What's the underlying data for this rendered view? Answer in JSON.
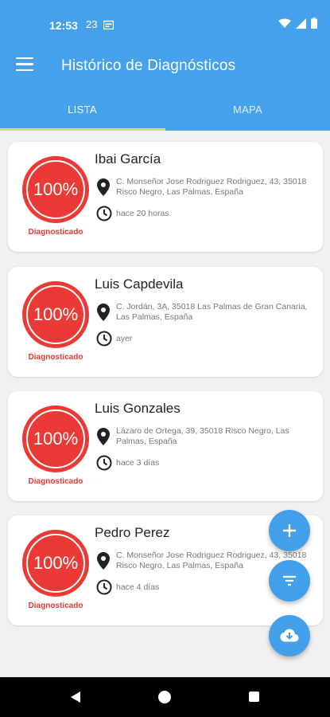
{
  "status_bar": {
    "time": "12:53",
    "indicator": "23"
  },
  "app_bar": {
    "title": "Histórico de Diagnósticos"
  },
  "tabs": [
    {
      "label": "LISTA",
      "selected": true
    },
    {
      "label": "MAPA",
      "selected": false
    }
  ],
  "colors": {
    "primary": "#45a1ec",
    "accent_indicator": "#cfe26a",
    "score_red": "#eb3a35"
  },
  "cards": [
    {
      "name": "Ibai García",
      "score": "100%",
      "status": "Diagnosticado",
      "address": "C. Monseñor Jose Rodriguez Rodriguez, 43, 35018 Risco Negro, Las Palmas, España",
      "time": "hace 20 horas"
    },
    {
      "name": "Luis  Capdevila",
      "score": "100%",
      "status": "Diagnosticado",
      "address": "C. Jordán, 3A, 35018 Las Palmas de Gran Canaria, Las Palmas, España",
      "time": "ayer"
    },
    {
      "name": "Luis Gonzales",
      "score": "100%",
      "status": "Diagnosticado",
      "address": "Lázaro de Ortega, 39, 35018 Risco Negro, Las Palmas, España",
      "time": "hace 3 días"
    },
    {
      "name": "Pedro Perez",
      "score": "100%",
      "status": "Diagnosticado",
      "address": "C. Monseñor Jose Rodriguez Rodriguez, 43, 35018 Risco Negro, Las Palmas, España",
      "time": "hace 4 días"
    }
  ],
  "fabs": [
    {
      "icon": "add-icon"
    },
    {
      "icon": "filter-icon"
    },
    {
      "icon": "cloud-download-icon"
    }
  ]
}
